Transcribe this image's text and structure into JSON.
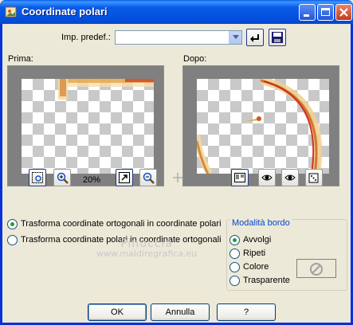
{
  "window": {
    "title": "Coordinate polari"
  },
  "preset": {
    "label": "Imp. predef.:",
    "value": ""
  },
  "preview": {
    "before_label": "Prima:",
    "after_label": "Dopo:",
    "zoom": "20%"
  },
  "transform": {
    "options": [
      {
        "label": "Trasforma coordinate ortogonali in coordinate polari",
        "selected": true
      },
      {
        "label": "Trasforma coordinate polari in coordinate ortogonali",
        "selected": false
      }
    ]
  },
  "edge_mode": {
    "title": "Modalità bordo",
    "options": [
      {
        "label": "Avvolgi",
        "selected": true
      },
      {
        "label": "Ripeti",
        "selected": false
      },
      {
        "label": "Colore",
        "selected": false
      },
      {
        "label": "Trasparente",
        "selected": false
      }
    ]
  },
  "watermark": {
    "line1": "Pinuccia",
    "line2": "www.maidiregrafica.eu"
  },
  "buttons": {
    "ok": "OK",
    "cancel": "Annulla",
    "help": "?"
  },
  "colors": {
    "title_bar": "#0a5ce8",
    "dialog_bg": "#ece9d8",
    "group_title": "#0046d5",
    "radio_dot": "#21a121"
  }
}
